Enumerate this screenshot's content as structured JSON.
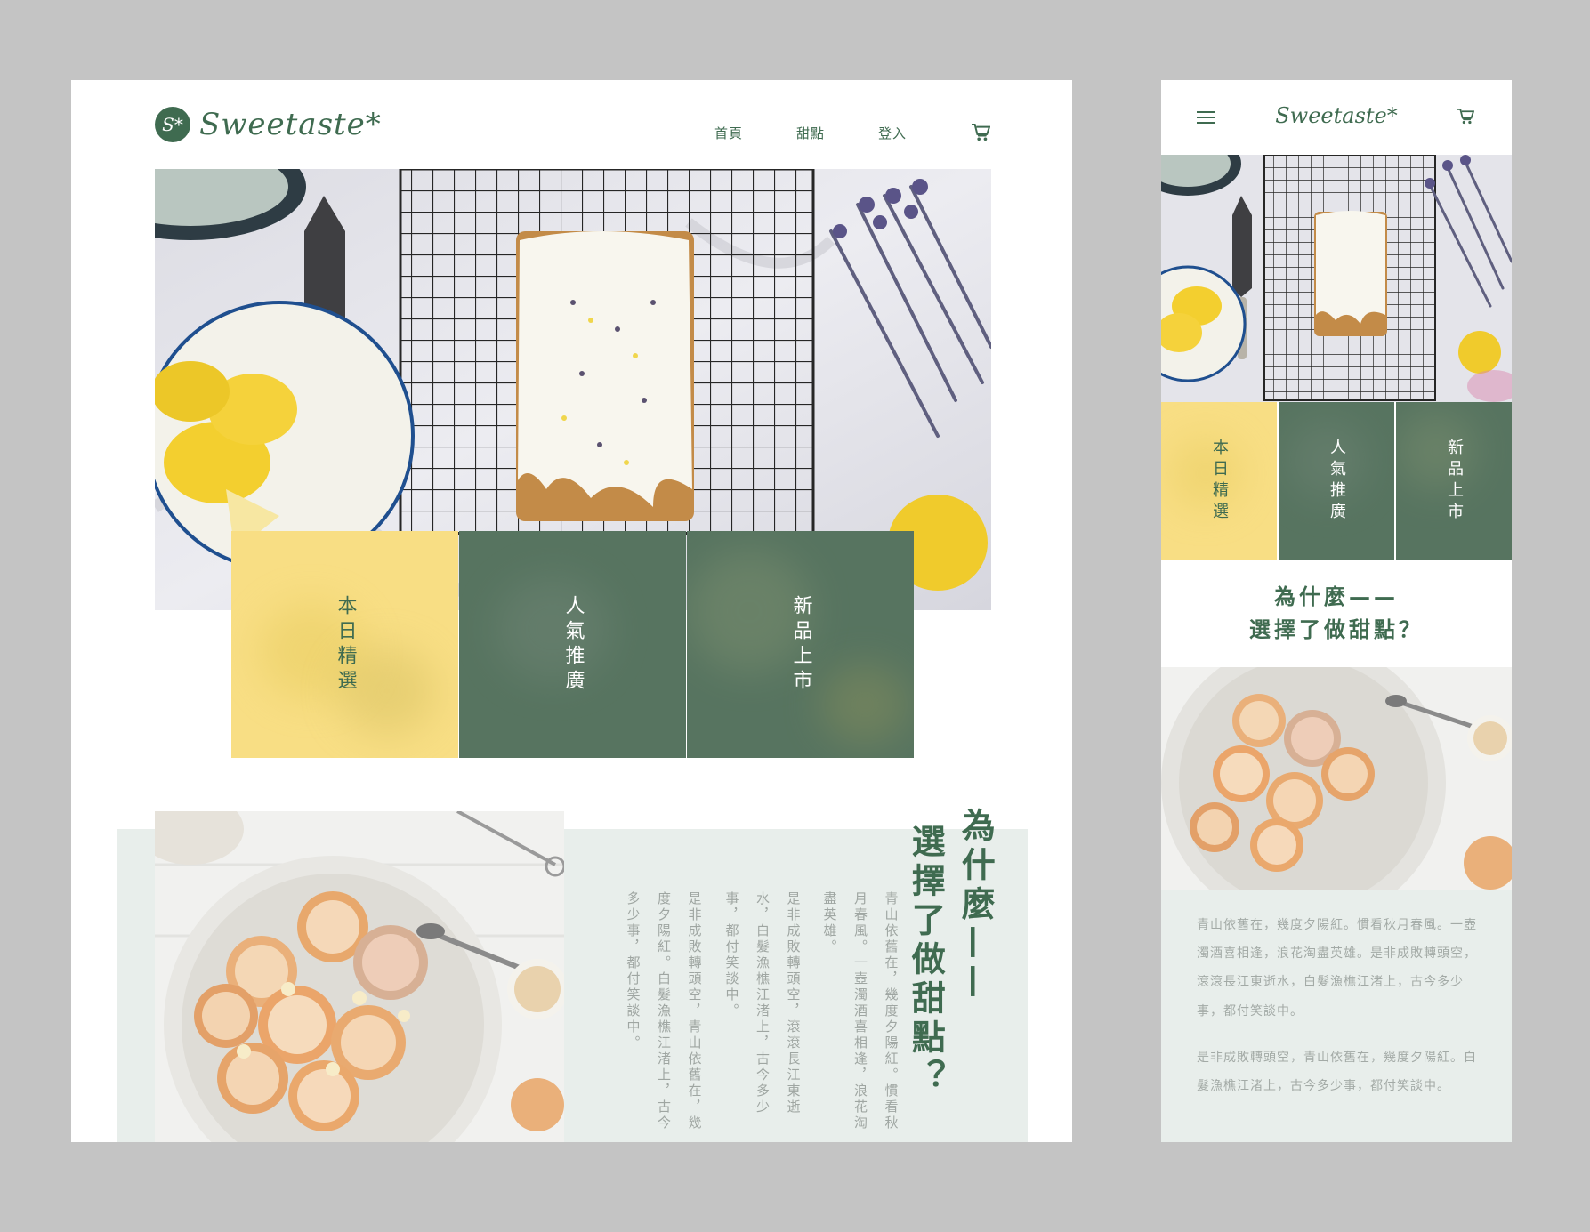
{
  "brand": {
    "name": "Sweetaste*",
    "badge": "S*"
  },
  "nav": {
    "home": "首頁",
    "desserts": "甜點",
    "login": "登入"
  },
  "icons": {
    "cart": "cart-icon",
    "menu": "hamburger-menu-icon"
  },
  "tiles": [
    {
      "label": "本日精選",
      "color": "#f8de84"
    },
    {
      "label": "人氣推廣",
      "color": "#577460"
    },
    {
      "label": "新品上市",
      "color": "#577460"
    }
  ],
  "why": {
    "desktop_line1": "為什麼——",
    "desktop_line2": "選擇了做甜點？",
    "mobile_line1": "為什麼——",
    "mobile_line2": "選擇了做甜點？"
  },
  "desktop_paragraphs": [
    "青山依舊在，幾度夕陽紅。慣看秋月春風。一壺濁酒喜相逢，浪花淘盡英雄。",
    "是非成敗轉頭空，滾滾長江東逝水，白髮漁樵江渚上，古今多少事，都付笑談中。",
    "是非成敗轉頭空，青山依舊在，幾度夕陽紅。白髮漁樵江渚上，古今多少事，都付笑談中。"
  ],
  "mobile_paragraphs": [
    "青山依舊在，幾度夕陽紅。慣看秋月春風。一壺濁酒喜相逢，浪花淘盡英雄。是非成敗轉頭空，滾滾長江東逝水，白髮漁樵江渚上，古今多少事，都付笑談中。",
    "是非成敗轉頭空，青山依舊在，幾度夕陽紅。白髮漁樵江渚上，古今多少事，都付笑談中。"
  ],
  "colors": {
    "brand_green": "#3f6b50",
    "tile_green": "#577460",
    "tile_yellow": "#f8de84",
    "section_bg": "#e8eeeb",
    "canvas_bg": "#c4c4c4"
  }
}
